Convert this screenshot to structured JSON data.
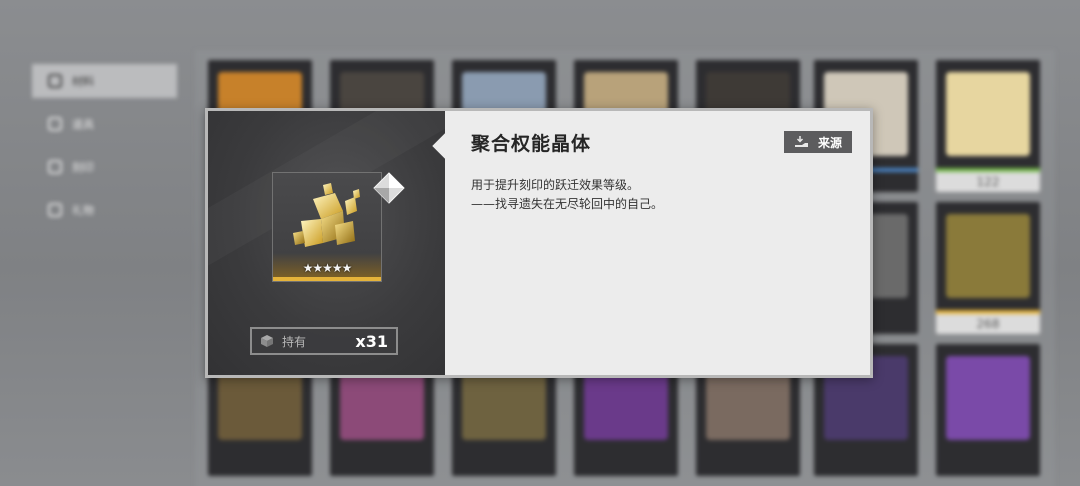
{
  "sidebar": {
    "items": [
      {
        "label": "材料",
        "icon": "materials-icon",
        "active": true
      },
      {
        "label": "道具",
        "icon": "items-icon",
        "active": false
      },
      {
        "label": "刻印",
        "icon": "imprint-icon",
        "active": false
      },
      {
        "label": "礼物",
        "icon": "gift-icon",
        "active": false
      }
    ]
  },
  "inventory": {
    "visible_counts": [
      "122",
      "268"
    ]
  },
  "item_detail": {
    "name": "聚合权能晶体",
    "source_label": "来源",
    "description_lines": [
      "用于提升刻印的跃迁效果等级。",
      "——找寻遗失在无尽轮回中的自己。"
    ],
    "owned_label": "持有",
    "owned_count": "x31",
    "star_rating": 5,
    "stars_text": "★★★★★",
    "rarity_color": "#e5b33a"
  }
}
